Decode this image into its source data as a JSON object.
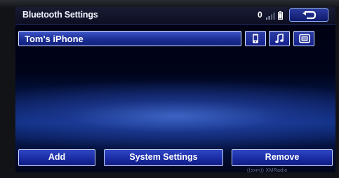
{
  "header": {
    "title": "Bluetooth Settings",
    "phone_count": "0"
  },
  "device": {
    "name": "Tom's iPhone",
    "profile_icons": [
      "phone-icon",
      "music-note-icon",
      "message-icon"
    ]
  },
  "actions": {
    "add_label": "Add",
    "system_settings_label": "System Settings",
    "remove_label": "Remove"
  },
  "footer": {
    "logo_text": "((sxm)) XMRadio"
  },
  "colors": {
    "accent": "#1c2e96",
    "border": "#d7e3ff",
    "text": "#ffffff"
  }
}
